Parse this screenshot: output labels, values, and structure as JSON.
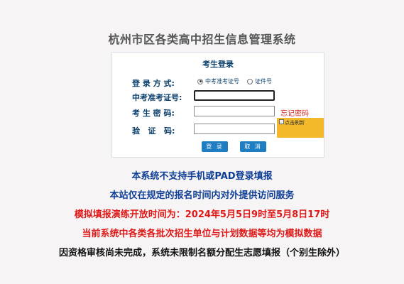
{
  "site": {
    "title": "杭州市区各类高中招生信息管理系统"
  },
  "login": {
    "title": "考生登录",
    "mode_label": "登 录 方 式:",
    "mode_options": [
      "中考准考证号",
      "证件号"
    ],
    "exam_id_label": "中考准考证号:",
    "password_label": "考 生 密 码:",
    "forgot_label": "忘记密码",
    "captcha_label": "验   证   码:",
    "captcha_image_alt": "点击刷新",
    "login_button": "登 录",
    "cancel_button": "取 消"
  },
  "notices": [
    {
      "text": "本系统不支持手机或PAD登录填报",
      "color": "#0e3f96"
    },
    {
      "text": "本站仅在规定的报名时间内对外提供访问服务",
      "color": "#0e3f96"
    },
    {
      "text": "模拟填报演练开放时间为：2024年5月5日9时至5月8日17时",
      "color": "#e01818"
    },
    {
      "text": "当前系统中各类各批次招生单位与计划数据等均为模拟数据",
      "color": "#e01818"
    },
    {
      "text": "因资格审核尚未完成，系统未限制名额分配生志愿填报（个别生除外）",
      "color": "#111111"
    }
  ]
}
